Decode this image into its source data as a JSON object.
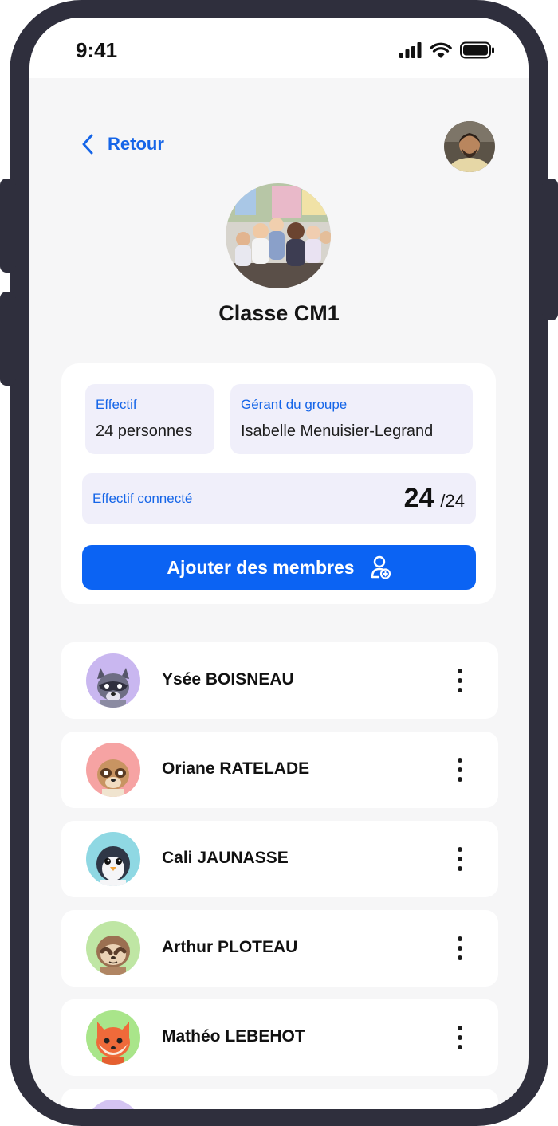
{
  "status_bar": {
    "time": "9:41"
  },
  "nav": {
    "back_label": "Retour"
  },
  "group": {
    "title": "Classe CM1",
    "effectif_label": "Effectif",
    "effectif_value": "24 personnes",
    "manager_label": "Gérant du groupe",
    "manager_value": "Isabelle Menuisier-Legrand",
    "connected_label": "Effectif connecté",
    "connected_count": "24",
    "connected_total": "/24",
    "add_members_label": "Ajouter des membres"
  },
  "members": [
    {
      "name": "Ysée BOISNEAU",
      "avatar": "raccoon-avatar",
      "bg": "#c9b7f0"
    },
    {
      "name": "Oriane RATELADE",
      "avatar": "meerkat-avatar",
      "bg": "#f6a3a3"
    },
    {
      "name": "Cali JAUNASSE",
      "avatar": "penguin-avatar",
      "bg": "#8fd8e3"
    },
    {
      "name": "Arthur PLOTEAU",
      "avatar": "sloth-avatar",
      "bg": "#bfe6a4"
    },
    {
      "name": "Mathéo LEBEHOT",
      "avatar": "fox-avatar",
      "bg": "#a9e58a"
    }
  ],
  "colors": {
    "accent": "#0b63f3",
    "chip_bg": "#f0effa",
    "frame": "#2f2f3d"
  }
}
